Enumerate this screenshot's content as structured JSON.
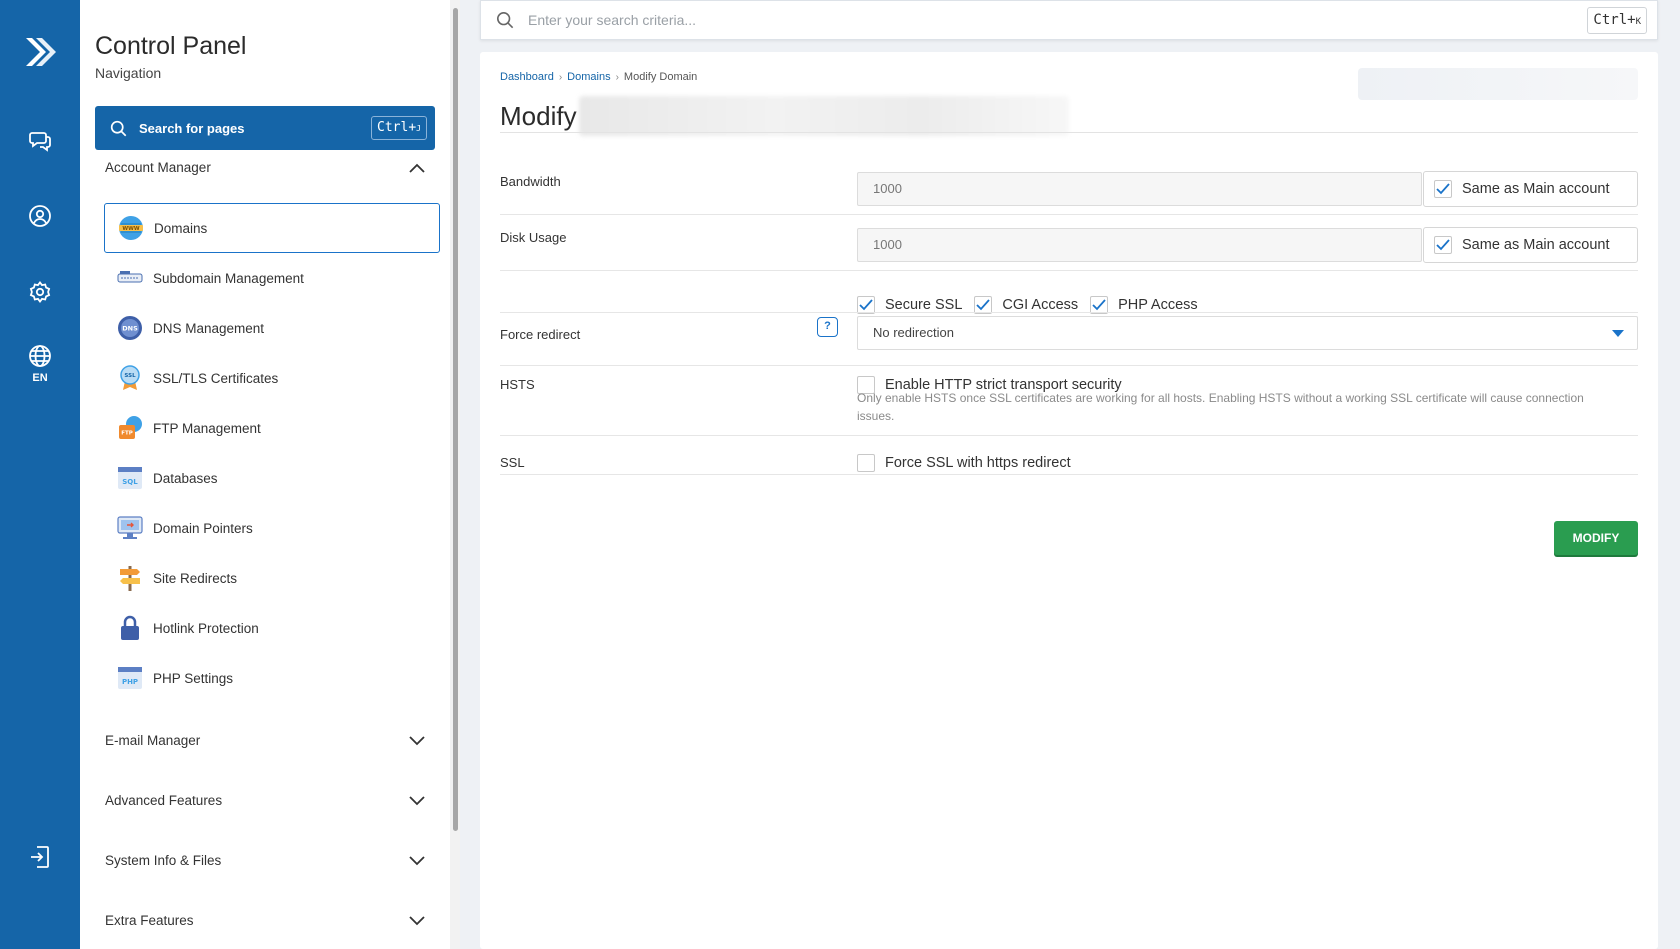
{
  "rail": {
    "items": [
      {
        "name": "logo-icon"
      },
      {
        "name": "chat-icon"
      },
      {
        "name": "user-icon"
      },
      {
        "name": "gear-icon"
      },
      {
        "name": "globe-icon",
        "label": "EN"
      },
      {
        "name": "logout-icon"
      }
    ]
  },
  "nav": {
    "title": "Control Panel",
    "subtitle": "Navigation",
    "search_label": "Search for pages",
    "search_shortcut_main": "Ctrl+",
    "search_shortcut_key": "J",
    "sections": {
      "account_manager": "Account Manager",
      "email_manager": "E-mail Manager",
      "advanced_features": "Advanced Features",
      "system_info": "System Info & Files",
      "extra_features": "Extra Features"
    },
    "items": [
      {
        "label": "Domains",
        "icon": "www-globe-icon"
      },
      {
        "label": "Subdomain Management",
        "icon": "subdomain-icon"
      },
      {
        "label": "DNS Management",
        "icon": "dns-icon"
      },
      {
        "label": "SSL/TLS Certificates",
        "icon": "ssl-badge-icon"
      },
      {
        "label": "FTP Management",
        "icon": "ftp-folder-icon"
      },
      {
        "label": "Databases",
        "icon": "sql-database-icon"
      },
      {
        "label": "Domain Pointers",
        "icon": "domain-pointer-icon"
      },
      {
        "label": "Site Redirects",
        "icon": "signpost-icon"
      },
      {
        "label": "Hotlink Protection",
        "icon": "padlock-icon"
      },
      {
        "label": "PHP Settings",
        "icon": "php-window-icon"
      }
    ]
  },
  "topsearch": {
    "placeholder": "Enter your search criteria...",
    "shortcut_main": "Ctrl+",
    "shortcut_key": "K"
  },
  "breadcrumb": {
    "items": [
      "Dashboard",
      "Domains",
      "Modify Domain"
    ]
  },
  "page": {
    "title": "Modify"
  },
  "form": {
    "bandwidth": {
      "label": "Bandwidth",
      "value": "1000",
      "same_label": "Same as Main account",
      "same_checked": true
    },
    "disk_usage": {
      "label": "Disk Usage",
      "value": "1000",
      "same_label": "Same as Main account",
      "same_checked": true
    },
    "options": [
      {
        "label": "Secure SSL",
        "checked": true
      },
      {
        "label": "CGI Access",
        "checked": true
      },
      {
        "label": "PHP Access",
        "checked": true
      }
    ],
    "force_redirect": {
      "label": "Force redirect",
      "help": "?",
      "value": "No redirection"
    },
    "hsts": {
      "label": "HSTS",
      "checkbox_label": "Enable HTTP strict transport security",
      "checked": false,
      "hint": "Only enable HSTS once SSL certificates are working for all hosts. Enabling HSTS without a working SSL certificate will cause connection issues."
    },
    "ssl": {
      "label": "SSL",
      "checkbox_label": "Force SSL with https redirect",
      "checked": false
    },
    "submit_label": "MODIFY"
  },
  "colors": {
    "brand_blue": "#1565a8",
    "accent_blue": "#1a73c9",
    "submit_green": "#2a9d50"
  }
}
